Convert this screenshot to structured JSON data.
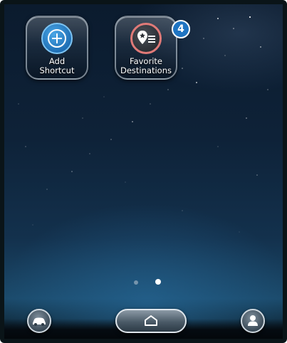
{
  "shortcuts": [
    {
      "label": "Add\nShortcut",
      "icon": "plus-icon"
    },
    {
      "label": "Favorite\nDestinations",
      "icon": "favorite-destinations-icon",
      "badge": "4"
    }
  ],
  "pager": {
    "pages": 2,
    "current": 2
  },
  "dock": {
    "left_icon": "car-icon",
    "center_icon": "home-icon",
    "right_icon": "user-icon"
  },
  "colors": {
    "accent_blue": "#1f74c2",
    "favorite_ring": "#e07a78"
  }
}
